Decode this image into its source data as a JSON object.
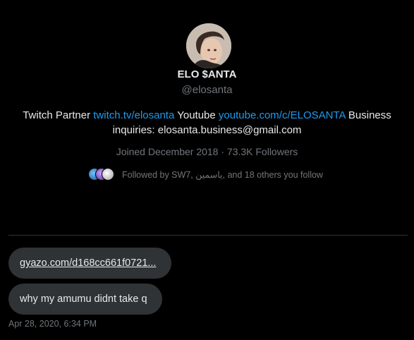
{
  "profile": {
    "display_name": "ELO $ANTA",
    "handle": "@elosanta",
    "bio": {
      "part1": "Twitch Partner ",
      "link1": "twitch.tv/elosanta",
      "part2": " Youtube ",
      "link2": "youtube.com/c/ELOSANTA",
      "part3": " Business inquiries: elosanta.business@gmail.com"
    },
    "meta": "Joined December 2018 · 73.3K Followers",
    "followed_by": "Followed by SW7, ياسمين, and 18 others you follow"
  },
  "messages": [
    {
      "text": "gyazo.com/d168cc661f0721...",
      "kind": "link"
    },
    {
      "text": "why my amumu didnt take q",
      "kind": "text"
    }
  ],
  "timestamp": "Apr 28, 2020, 6:34 PM",
  "colors": {
    "background": "#000000",
    "text": "#e7e9ea",
    "muted": "#71767b",
    "link": "#1d9bf0",
    "bubble": "#2f3336"
  },
  "icons": {
    "avatar": "profile-photo",
    "followers": [
      "follower-avatar-1",
      "follower-avatar-2",
      "follower-avatar-3"
    ]
  }
}
